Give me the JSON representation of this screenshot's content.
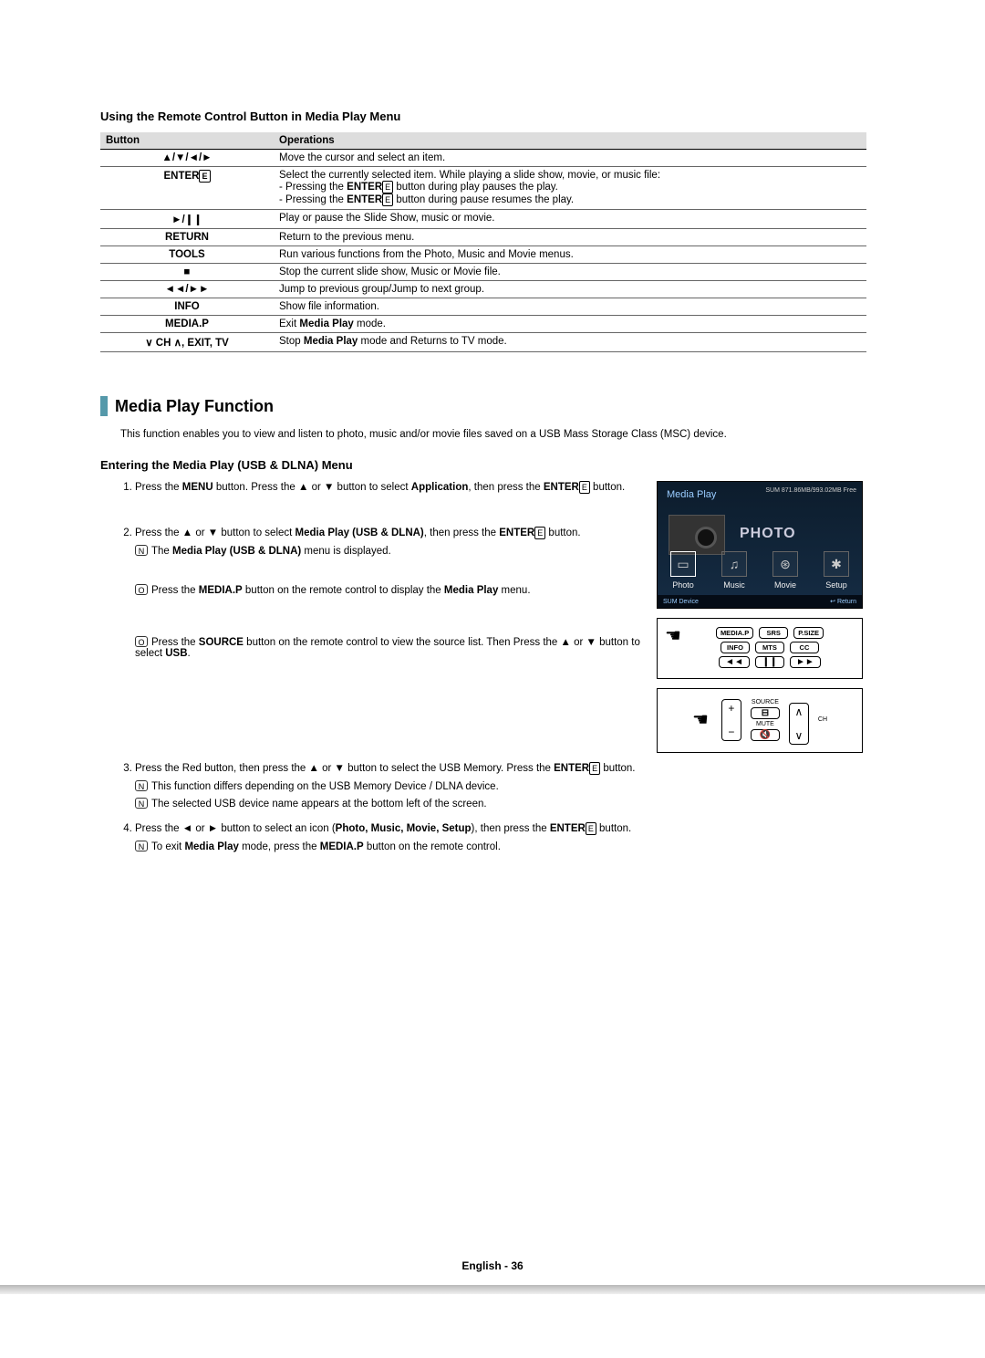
{
  "headings": {
    "remote_table": "Using the Remote Control Button in Media Play Menu",
    "section": "Media Play Function",
    "entering": "Entering the Media Play (USB & DLNA) Menu"
  },
  "table": {
    "head_button": "Button",
    "head_ops": "Operations",
    "rows": [
      {
        "btn": "▲/▼/◄/►",
        "op": "Move the cursor and select an item."
      },
      {
        "btn": "ENTER",
        "op_line1": "Select the currently selected item. While playing a slide show, movie, or music file:",
        "op_line2_a": "- Pressing the ",
        "op_line2_b": "ENTER",
        "op_line2_c": " button during play pauses the play.",
        "op_line3_a": "- Pressing the ",
        "op_line3_b": "ENTER",
        "op_line3_c": " button during pause resumes the play."
      },
      {
        "btn": "►/❙❙",
        "op": "Play or pause the Slide Show, music or movie."
      },
      {
        "btn": "RETURN",
        "op": "Return to the previous menu."
      },
      {
        "btn": "TOOLS",
        "op": "Run various functions from the Photo, Music and Movie menus."
      },
      {
        "btn": "■",
        "op": "Stop the current slide show, Music or Movie file."
      },
      {
        "btn": "◄◄/►►",
        "op": "Jump to previous group/Jump to next group."
      },
      {
        "btn": "INFO",
        "op": "Show file information."
      },
      {
        "btn": "MEDIA.P",
        "op_a": "Exit ",
        "op_b": "Media Play",
        "op_c": " mode."
      },
      {
        "btn": "∨ CH ∧, EXIT, TV",
        "op_a": "Stop ",
        "op_b": "Media Play",
        "op_c": " mode and Returns to TV mode."
      }
    ]
  },
  "intro": "This function enables you to view and listen to photo, music and/or movie files saved on a USB Mass Storage Class (MSC) device.",
  "glyph": {
    "enter": "E"
  },
  "steps": {
    "s1_a": "Press the ",
    "s1_b": "MENU",
    "s1_c": " button. Press the ▲ or ▼ button to select ",
    "s1_d": "Application",
    "s1_e": ", then press the ",
    "s1_f": "ENTER",
    "s1_g": " button.",
    "s2_a": "Press the ▲ or ▼ button to select ",
    "s2_b": "Media Play (USB & DLNA)",
    "s2_c": ", then press the ",
    "s2_d": "ENTER",
    "s2_e": " button.",
    "s2_n1_a": "The ",
    "s2_n1_b": "Media Play (USB & DLNA)",
    "s2_n1_c": " menu is displayed.",
    "s2_n2_a": "Press the ",
    "s2_n2_b": "MEDIA.P",
    "s2_n2_c": " button on the remote control to display the ",
    "s2_n2_d": "Media Play",
    "s2_n2_e": " menu.",
    "s2_n3_a": "Press the ",
    "s2_n3_b": "SOURCE",
    "s2_n3_c": " button on the remote control to view the source list. Then Press the ▲ or ▼ button to select ",
    "s2_n3_d": "USB",
    "s2_n3_e": ".",
    "s3_a": "Press the Red button, then press the ▲ or ▼ button to select the USB Memory. Press the ",
    "s3_b": "ENTER",
    "s3_c": " button.",
    "s3_n1": "This function differs depending on the USB Memory Device / DLNA device.",
    "s3_n2": "The selected USB device name appears at the bottom left of the screen.",
    "s4_a": "Press the ◄ or ► button to select an icon (",
    "s4_b": "Photo, Music, Movie, Setup",
    "s4_c": "), then press the ",
    "s4_d": "ENTER",
    "s4_e": " button.",
    "s4_n1_a": "To exit ",
    "s4_n1_b": "Media Play",
    "s4_n1_c": " mode, press the ",
    "s4_n1_d": "MEDIA.P",
    "s4_n1_e": " button on the remote control."
  },
  "tvshot": {
    "title": "Media Play",
    "sum": "SUM   871.86MB/993.02MB Free",
    "big": "PHOTO",
    "icons": {
      "photo": "Photo",
      "music": "Music",
      "movie": "Movie",
      "setup": "Setup"
    },
    "bar_left": "SUM    Device",
    "bar_right": "↩ Return"
  },
  "remote1": {
    "r1": [
      "MEDIA.P",
      "SRS",
      "P.SIZE"
    ],
    "r2": [
      "INFO",
      "MTS",
      "CC"
    ],
    "r3": [
      "◄◄",
      "❙❙",
      "►►"
    ]
  },
  "remote2": {
    "source": "SOURCE",
    "mute": "MUTE",
    "ch": "CH"
  },
  "footer": "English - 36"
}
